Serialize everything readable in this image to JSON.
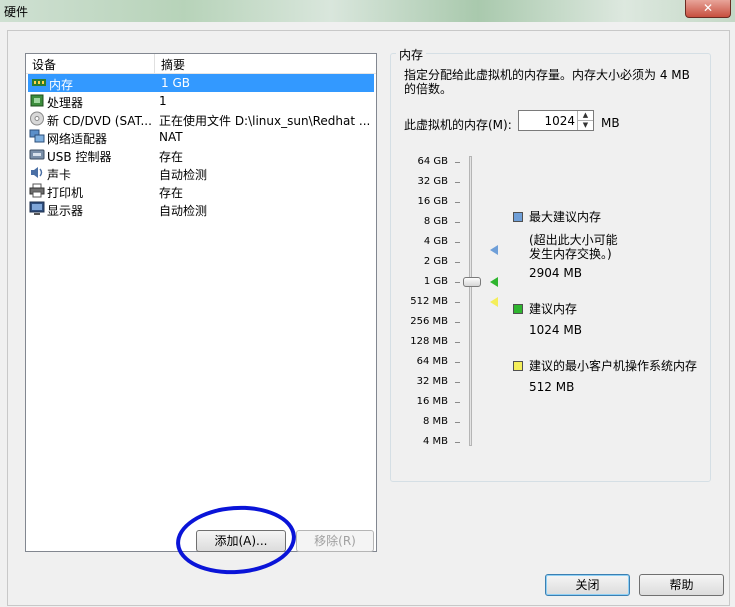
{
  "window": {
    "title": "硬件",
    "close_glyph": "✕"
  },
  "devices": {
    "headers": {
      "device": "设备",
      "summary": "摘要"
    },
    "items": [
      {
        "icon": "memory-icon",
        "name": "内存",
        "summary": "1 GB",
        "selected": true
      },
      {
        "icon": "cpu-icon",
        "name": "处理器",
        "summary": "1"
      },
      {
        "icon": "cd-dvd-icon",
        "name": "新 CD/DVD (SAT...",
        "summary": "正在使用文件 D:\\linux_sun\\Redhat ..."
      },
      {
        "icon": "network-adapter-icon",
        "name": "网络适配器",
        "summary": "NAT"
      },
      {
        "icon": "usb-icon",
        "name": "USB 控制器",
        "summary": "存在"
      },
      {
        "icon": "sound-card-icon",
        "name": "声卡",
        "summary": "自动检测"
      },
      {
        "icon": "printer-icon",
        "name": "打印机",
        "summary": "存在"
      },
      {
        "icon": "display-icon",
        "name": "显示器",
        "summary": "自动检测"
      }
    ]
  },
  "buttons": {
    "add": "添加(A)...",
    "remove": "移除(R)",
    "close": "关闭",
    "help": "帮助"
  },
  "memory": {
    "group_title": "内存",
    "description": "指定分配给此虚拟机的内存量。内存大小必须为 4 MB 的倍数。",
    "field_label": "此虚拟机的内存(M):",
    "value": "1024",
    "unit": "MB",
    "scale": [
      "64 GB",
      "32 GB",
      "16 GB",
      "8 GB",
      "4 GB",
      "2 GB",
      "1 GB",
      "512 MB",
      "256 MB",
      "128 MB",
      "64 MB",
      "32 MB",
      "16 MB",
      "8 MB",
      "4 MB"
    ],
    "legend": {
      "max": {
        "title": "最大建议内存",
        "note": "(超出此大小可能\n发生内存交换。)",
        "value": "2904 MB",
        "color": "#6f9fd8"
      },
      "recommended": {
        "title": "建议内存",
        "value": "1024 MB",
        "color": "#2fb52f"
      },
      "min": {
        "title": "建议的最小客户机操作系统内存",
        "value": "512 MB",
        "color": "#f4ee5a"
      }
    }
  }
}
